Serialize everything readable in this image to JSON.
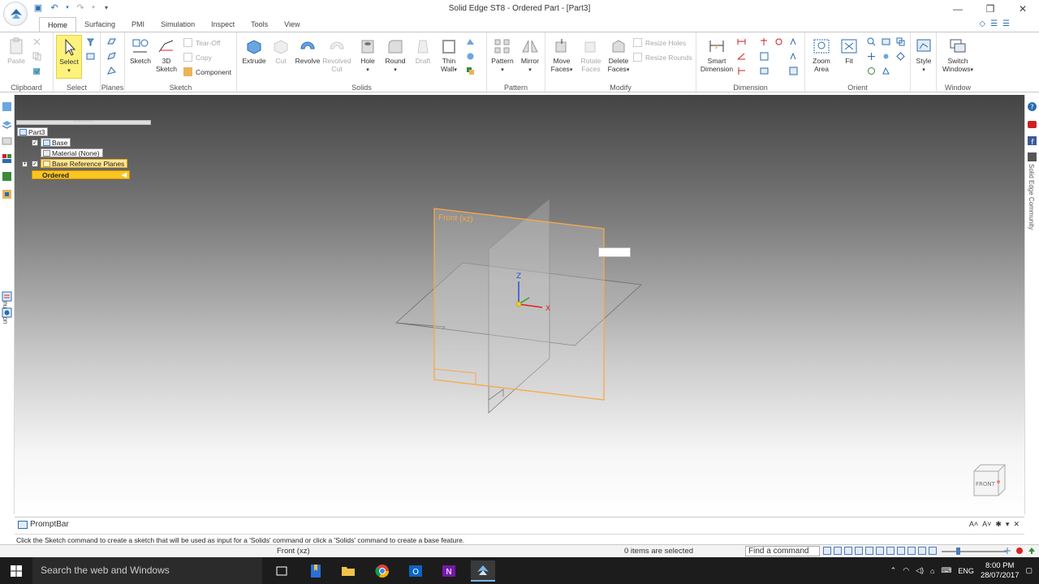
{
  "window": {
    "title": "Solid Edge ST8 - Ordered Part - [Part3]",
    "controls": {
      "minimize": "—",
      "maximize": "❐",
      "close": "✕"
    }
  },
  "tabs": [
    "Home",
    "Surfacing",
    "PMI",
    "Simulation",
    "Inspect",
    "Tools",
    "View"
  ],
  "ribbon": {
    "clipboard": {
      "label": "Clipboard",
      "paste": "Paste"
    },
    "select": {
      "label": "Select",
      "select": "Select"
    },
    "planes": {
      "label": "Planes"
    },
    "sketch": {
      "label": "Sketch",
      "sketch": "Sketch",
      "sketch3d_line1": "3D",
      "sketch3d_line2": "Sketch",
      "tear_off": "Tear-Off",
      "copy": "Copy",
      "component": "Component"
    },
    "solids": {
      "label": "Solids",
      "extrude": "Extrude",
      "cut": "Cut",
      "revolve": "Revolve",
      "revolved_cut_line1": "Revolved",
      "revolved_cut_line2": "Cut",
      "hole": "Hole",
      "round": "Round",
      "draft": "Draft",
      "thin_wall_line1": "Thin",
      "thin_wall_line2": "Wall"
    },
    "pattern": {
      "label": "Pattern",
      "pattern": "Pattern",
      "mirror": "Mirror"
    },
    "modify": {
      "label": "Modify",
      "move_faces_line1": "Move",
      "move_faces_line2": "Faces",
      "rotate_faces_line1": "Rotate",
      "rotate_faces_line2": "Faces",
      "delete_faces_line1": "Delete",
      "delete_faces_line2": "Faces",
      "resize_holes": "Resize Holes",
      "resize_rounds": "Resize Rounds"
    },
    "dimension": {
      "label": "Dimension",
      "smart_line1": "Smart",
      "smart_line2": "Dimension"
    },
    "orient": {
      "label": "Orient",
      "zoom_area_line1": "Zoom",
      "zoom_area_line2": "Area",
      "fit": "Fit"
    },
    "style": {
      "style": "Style"
    },
    "window": {
      "label": "Window",
      "switch_line1": "Switch",
      "switch_line2": "Windows"
    }
  },
  "left_bar": {
    "simulation": "Simulation"
  },
  "right_bar": {
    "community": "Solid Edge Community"
  },
  "tree": {
    "root": "Part3",
    "base": "Base",
    "material": "Material (None)",
    "ref_planes": "Base Reference Planes",
    "ordered": "Ordered"
  },
  "viewport": {
    "front_plane_label": "Front (xz)",
    "axis_z": "Z",
    "axis_x": "X",
    "view_cube_label": "FRONT"
  },
  "promptbar": {
    "title": "PromptBar",
    "text": "Click the Sketch command to create a sketch that will be used as input for a 'Solids' command or click a 'Solids' command to create a base feature.",
    "tools": [
      "A˄",
      "A˅",
      "✱",
      "▾",
      "✕"
    ]
  },
  "status": {
    "view": "Front (xz)",
    "selection": "0 items are selected",
    "find_command": "Find a command"
  },
  "taskbar": {
    "search": "Search the web and Windows",
    "language": "ENG",
    "time": "8:00 PM",
    "date": "28/07/2017"
  },
  "colors": {
    "accent": "#2b6cb0",
    "select_highlight": "#fdf27b",
    "plane_orange": "#f7a94a",
    "tree_selected": "#f9c520"
  }
}
